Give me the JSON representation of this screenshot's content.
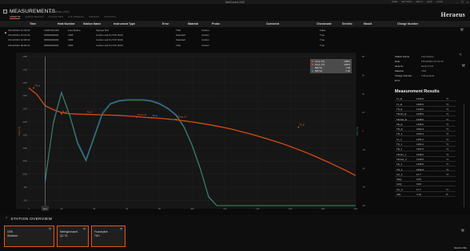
{
  "window": {
    "title": "MeltControl 2020",
    "links": [
      "USER",
      "SETTINGS",
      "ABOUT",
      "HELP",
      "LOGIN"
    ],
    "controls": [
      "—",
      "❐",
      "✕"
    ]
  },
  "header": {
    "title": "MEASUREMENTS",
    "subtitle": "Hot Metal (HM)",
    "brand": "Heraeus",
    "tabs": [
      "LATEST 50",
      "SEARCH RESULTS",
      "CUSTOM VIEW",
      "LIVE TRENDING",
      "TRENDING",
      "STATISTICS"
    ]
  },
  "grid": {
    "columns": [
      "Time",
      "Heat Number",
      "Station Name",
      "Instrument Type",
      "Error",
      "Material",
      "Probe",
      "Comment",
      "Checkmate",
      "Seriello",
      "Mould",
      "Charge Number"
    ],
    "rows": [
      [
        "15/12/2021 10:25:03",
        "LSWKS21006",
        "Foundryline",
        "Sample Box",
        "",
        "TDH",
        "Carbon",
        "",
        "False",
        "",
        "",
        ""
      ],
      [
        "15/12/2021 10:19:52",
        "MM00000000",
        "CRB",
        "Carbon-Lab 8 (TCP RUP)",
        "",
        "Standard",
        "Carbon",
        "",
        "True",
        "",
        "",
        ""
      ],
      [
        "15/12/2021 10:08:03",
        "MM00000000",
        "CRB",
        "Carbon-Lab 8 (TCP RUP)",
        "",
        "Standard",
        "Carbon",
        "",
        "True",
        "",
        "",
        ""
      ],
      [
        "15/12/2021 09:58:21",
        "MM00000000",
        "CRB",
        "Carbon-Lab 8 (TCP RUP)",
        "",
        "TDH",
        "Carbon",
        "",
        "True",
        "",
        "",
        ""
      ]
    ]
  },
  "chart_data": {
    "type": "line",
    "x": [
      0,
      5,
      10,
      15,
      20,
      25,
      30,
      35,
      40,
      45,
      50,
      55,
      60,
      65,
      70,
      75,
      80,
      85,
      90,
      95,
      100,
      105,
      110,
      115,
      120,
      125,
      130,
      135,
      140,
      145,
      150,
      155,
      160,
      165,
      170,
      175,
      180,
      185,
      190,
      195,
      200
    ],
    "xticks": [
      0,
      20,
      40,
      60,
      80,
      100,
      120,
      140,
      160,
      180,
      200
    ],
    "xlim": [
      0,
      200
    ],
    "ylim_left": [
      880,
      1450
    ],
    "yticks_left": [
      900,
      950,
      1000,
      1050,
      1100,
      1150,
      1200,
      1250,
      1300,
      1350,
      1400,
      1450
    ],
    "ylabel_left": "Temp [°C]",
    "ylim_right": [
      -80,
      80
    ],
    "yticks_right": [
      -80,
      -60,
      -40,
      -20,
      0,
      20,
      40,
      60,
      80
    ],
    "ylabel_right": "Diff [°C/s]",
    "cursor_x": 10,
    "cursor_label": "10.2",
    "legend": [
      {
        "name": "Temp. [°C]",
        "value": "1150.0"
      },
      {
        "name": "Temp. [°C]",
        "value": "1150.0"
      },
      {
        "name": "Diff [°/s]",
        "value": "-7.00"
      },
      {
        "name": "Diff [°/s]",
        "value": "-7.00"
      }
    ],
    "series": [
      {
        "name": "Temp. [°C]",
        "color": "#d64a14",
        "axis": "left",
        "values": [
          1330,
          1305,
          1262,
          1247,
          1236,
          1231,
          1230,
          1229,
          1228,
          1227,
          1226,
          1225,
          1223,
          1221,
          1218,
          1216,
          1214,
          1211,
          1208,
          1204,
          1200,
          1195,
          1190,
          1184,
          1178,
          1171,
          1163,
          1155,
          1146,
          1137,
          1127,
          1117,
          1106,
          1094,
          1082,
          1069,
          1055,
          1041,
          1026,
          1011,
          995
        ]
      },
      {
        "name": "Diff [°/s]",
        "color": "#2a4aa8",
        "axis": "right",
        "values": [
          null,
          null,
          -55,
          10,
          42,
          18,
          -12,
          -30,
          -5,
          20,
          30,
          33,
          34,
          34,
          34,
          33,
          30,
          25,
          18,
          5,
          -15,
          -40,
          -70,
          -80,
          -80,
          -80,
          -80,
          -80,
          -80,
          -80,
          -80,
          -80,
          -80,
          -80,
          -80,
          -80,
          -80,
          -80,
          -80,
          -80,
          -80
        ]
      },
      {
        "name": "Diff [°/s]",
        "color": "#3c8a54",
        "axis": "right",
        "values": [
          null,
          null,
          -52,
          8,
          41,
          17,
          -14,
          -32,
          -7,
          18,
          29,
          32,
          33,
          33,
          33,
          32,
          29,
          24,
          17,
          4,
          -16,
          -41,
          -71,
          -80,
          -80,
          -80,
          -80,
          -80,
          -80,
          -80,
          -80,
          -80,
          -80,
          -80,
          -80,
          -80,
          -80,
          -80,
          -80,
          -80,
          -80
        ]
      }
    ],
    "markers": [
      {
        "x": 3,
        "y": 1330,
        "label": "TR_H"
      },
      {
        "x": 20,
        "y": 1231,
        "label": "TL_E"
      },
      {
        "x": 35,
        "y": 1229,
        "label": "TS_H"
      },
      {
        "x": 66,
        "y": 1219,
        "label": "TSmin_H"
      },
      {
        "x": 75,
        "y": 1216,
        "label": "TE_H"
      },
      {
        "x": 90,
        "y": 1210,
        "label": "TSmax_H"
      },
      {
        "x": 165,
        "y": 1180,
        "label": "TS_E"
      }
    ]
  },
  "info": {
    "fields": [
      {
        "label": "Station Name",
        "value": "Foundryline"
      },
      {
        "label": "Date",
        "value": "15/12/2021 10:31:04"
      },
      {
        "label": "Heat Nr.",
        "value": "Recht 1721"
      },
      {
        "label": "Material",
        "value": "TDH"
      },
      {
        "label": "Charge Number",
        "value": "FridayHeat4"
      },
      {
        "label": "Error",
        "value": ""
      }
    ],
    "results_title": "Measurement Results",
    "results": [
      [
        "TL_E",
        "1230.0",
        "°C"
      ],
      [
        "TL_E",
        "1155.0",
        "°C"
      ],
      [
        "TS_E",
        "1149.0",
        "°C"
      ],
      [
        "TEmin_E",
        "1138.0",
        "°C"
      ],
      [
        "TEmax_E",
        "1138.0",
        "°C"
      ],
      [
        "TE_E",
        "1138.0",
        "°C"
      ],
      [
        "TR_E",
        "1092.2",
        "°C"
      ],
      [
        "TR_1",
        "1233.1",
        "°C"
      ],
      [
        "TL_1",
        "1151.2",
        "°C"
      ],
      [
        "TS_1",
        "1151.2",
        "°C"
      ],
      [
        "TE_1",
        "1151.5",
        "°C"
      ],
      [
        "TEmin_1",
        "1138.0",
        "°C"
      ],
      [
        "TEmax_1",
        "1138.5",
        "°C"
      ],
      [
        "TE_1",
        "1138.5",
        "°C"
      ],
      [
        "TR_1",
        "1092.6",
        "°C"
      ],
      [
        "CU_1",
        "17.7",
        "°C"
      ],
      [
        "CEQ",
        "0.03",
        ""
      ],
      [
        "CAQ",
        "0.00",
        ""
      ],
      [
        "CU_II",
        "17.7",
        "°C"
      ],
      [
        "CEL",
        "4.19",
        "%"
      ]
    ]
  },
  "overview": {
    "title": "STATION OVERVIEW",
    "cards": [
      {
        "line1": "CRB",
        "line2": "Standard"
      },
      {
        "line1": "Meltingfurnace1",
        "line2": "QC TA"
      },
      {
        "line1": "Foundryline",
        "line2": "TDH"
      }
    ],
    "footer": "Electro-Nite"
  }
}
